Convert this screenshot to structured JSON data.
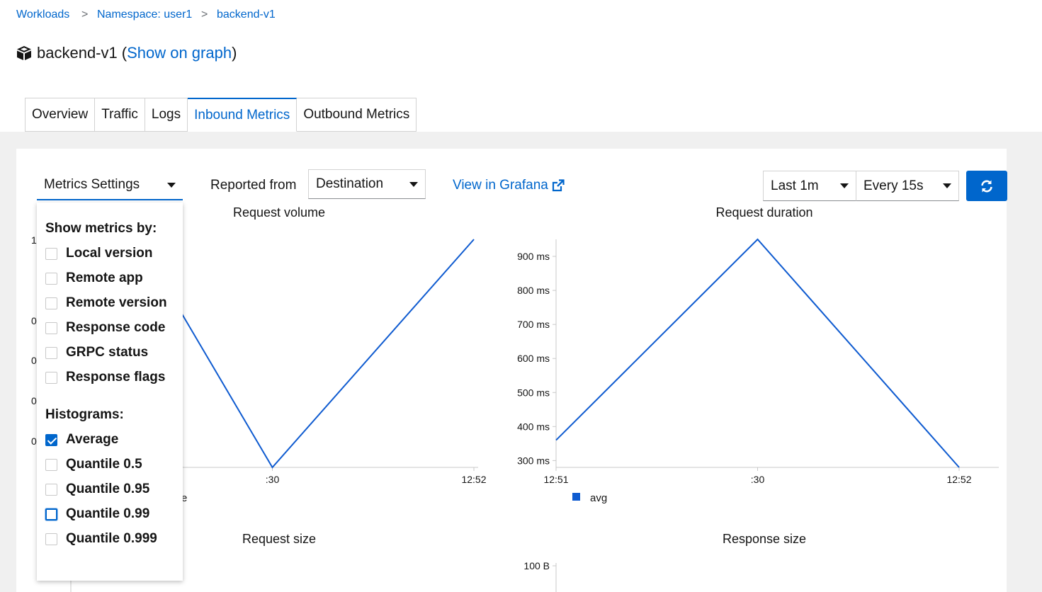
{
  "breadcrumb": {
    "items": [
      "Workloads",
      "Namespace: user1",
      "backend-v1"
    ],
    "separator": ">"
  },
  "header": {
    "workload_name": "backend-v1",
    "open_paren": "(",
    "graph_link": "Show on graph",
    "close_paren": ")"
  },
  "tabs": [
    {
      "label": "Overview",
      "active": false
    },
    {
      "label": "Traffic",
      "active": false
    },
    {
      "label": "Logs",
      "active": false
    },
    {
      "label": "Inbound Metrics",
      "active": true
    },
    {
      "label": "Outbound Metrics",
      "active": false
    }
  ],
  "toolbar": {
    "metrics_settings": "Metrics Settings",
    "reported_from_label": "Reported from",
    "reported_from_value": "Destination",
    "grafana_link": "View in Grafana",
    "duration": "Last 1m",
    "refresh_interval": "Every 15s"
  },
  "metrics_settings_menu": {
    "show_by_heading": "Show metrics by:",
    "show_by": [
      {
        "label": "Local version",
        "checked": false
      },
      {
        "label": "Remote app",
        "checked": false
      },
      {
        "label": "Remote version",
        "checked": false
      },
      {
        "label": "Response code",
        "checked": false
      },
      {
        "label": "GRPC status",
        "checked": false
      },
      {
        "label": "Response flags",
        "checked": false
      }
    ],
    "histograms_heading": "Histograms:",
    "histograms": [
      {
        "label": "Average",
        "checked": true
      },
      {
        "label": "Quantile 0.5",
        "checked": false
      },
      {
        "label": "Quantile 0.95",
        "checked": false
      },
      {
        "label": "Quantile 0.99",
        "checked": false,
        "focused": true
      },
      {
        "label": "Quantile 0.999",
        "checked": false
      }
    ]
  },
  "colors": {
    "accent": "#0066cc",
    "series": "#0f5bd0"
  },
  "chart_data": [
    {
      "type": "line",
      "title": "Request volume",
      "x_ticks": [
        ":30",
        "12:52"
      ],
      "visible_y_tick_fragments": [
        "1",
        "0",
        "0",
        "0",
        "0"
      ],
      "legend_fragment": "e",
      "series": [
        {
          "x": [
            "12:51:15",
            "12:51:30",
            "12:52"
          ],
          "y": [
            0.75,
            0,
            1
          ]
        }
      ]
    },
    {
      "type": "line",
      "title": "Request duration",
      "x_ticks": [
        "12:51",
        ":30",
        "12:52"
      ],
      "y_ticks": [
        "900 ms",
        "800 ms",
        "700 ms",
        "600 ms",
        "500 ms",
        "400 ms",
        "300 ms"
      ],
      "ylim": [
        280,
        950
      ],
      "series": [
        {
          "name": "avg",
          "x": [
            "12:51",
            "12:51:30",
            "12:52"
          ],
          "y": [
            360,
            950,
            280
          ]
        }
      ],
      "legend": [
        "avg"
      ]
    },
    {
      "type": "line",
      "title": "Request size",
      "series": []
    },
    {
      "type": "line",
      "title": "Response size",
      "y_ticks": [
        "100 B"
      ],
      "series": []
    }
  ]
}
